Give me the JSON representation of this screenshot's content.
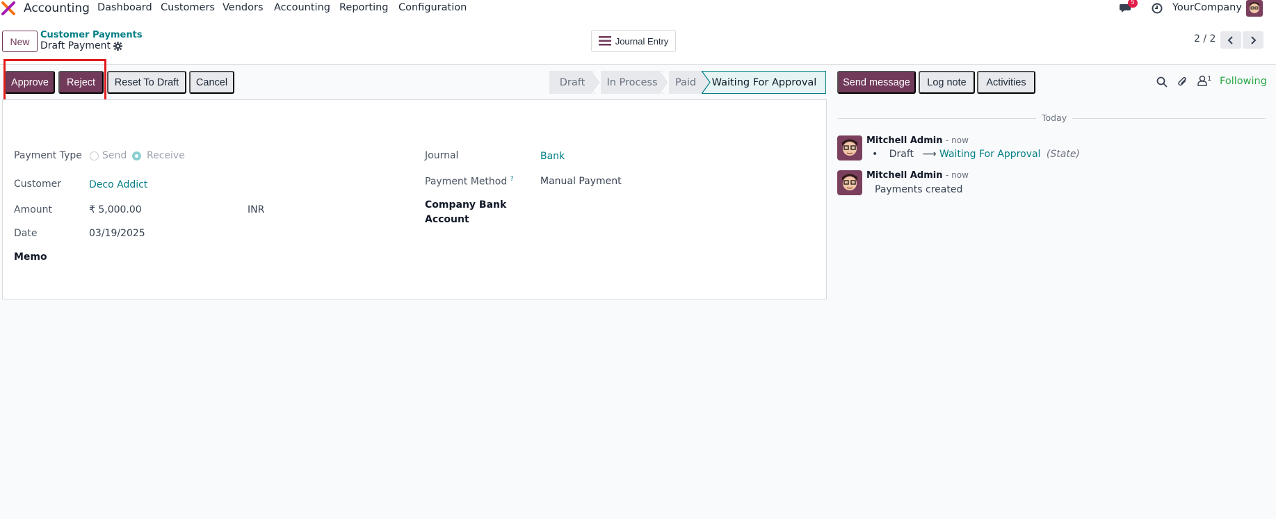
{
  "navbar": {
    "app_name": "Accounting",
    "menu": [
      "Dashboard",
      "Customers",
      "Vendors",
      "Accounting",
      "Reporting",
      "Configuration"
    ],
    "messages_count": "5",
    "company": "YourCompany"
  },
  "control_panel": {
    "new_label": "New",
    "breadcrumb": "Customer Payments",
    "record_name": "Draft Payment",
    "journal_entry_label": "Journal Entry",
    "pager": "2 / 2"
  },
  "actions": {
    "approve": "Approve",
    "reject": "Reject",
    "reset_to_draft": "Reset To Draft",
    "cancel": "Cancel"
  },
  "status": {
    "stages": [
      "Draft",
      "In Process",
      "Paid",
      "Waiting For Approval"
    ],
    "active": "Waiting For Approval"
  },
  "form": {
    "payment_type_label": "Payment Type",
    "payment_type_options": [
      "Send",
      "Receive"
    ],
    "payment_type_selected": "Receive",
    "customer_label": "Customer",
    "customer_value": "Deco Addict",
    "amount_label": "Amount",
    "amount_value": "₹ 5,000.00",
    "currency": "INR",
    "date_label": "Date",
    "date_value": "03/19/2025",
    "memo_label": "Memo",
    "journal_label": "Journal",
    "journal_value": "Bank",
    "payment_method_label": "Payment Method",
    "payment_method_help": "?",
    "payment_method_value": "Manual Payment",
    "company_bank_label_line1": "Company Bank",
    "company_bank_label_line2": "Account"
  },
  "chatter": {
    "send_message": "Send message",
    "log_note": "Log note",
    "activities": "Activities",
    "followers_count": "1",
    "following": "Following",
    "date_separator": "Today",
    "messages": [
      {
        "author": "Mitchell Admin",
        "time": "- now",
        "from": "Draft",
        "to": "Waiting For Approval",
        "field": "(State)"
      },
      {
        "author": "Mitchell Admin",
        "time": "- now",
        "body": "Payments created"
      }
    ]
  },
  "colors": {
    "brand": "#71395a",
    "link": "#017e84",
    "highlight": "#e21b1b",
    "following": "#28a745"
  }
}
